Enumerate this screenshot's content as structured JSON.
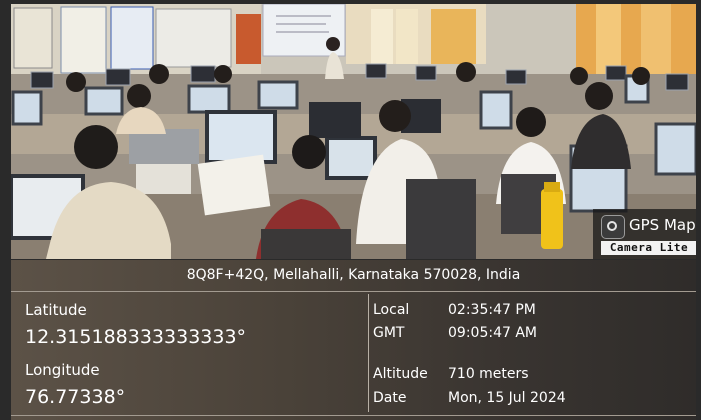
{
  "badge": {
    "title": "GPS Map",
    "subtitle": "Camera Lite",
    "icon": "camera-icon"
  },
  "address": "8Q8F+42Q, Mellahalli, Karnataka 570028, India",
  "latitude": {
    "label": "Latitude",
    "value": "12.315188333333333°"
  },
  "longitude": {
    "label": "Longitude",
    "value": "76.77338°"
  },
  "local": {
    "label": "Local",
    "value": "02:35:47 PM"
  },
  "gmt": {
    "label": "GMT",
    "value": "09:05:47 AM"
  },
  "altitude": {
    "label": "Altitude",
    "value": "710 meters"
  },
  "date": {
    "label": "Date",
    "value": "Mon, 15 Jul 2024"
  }
}
